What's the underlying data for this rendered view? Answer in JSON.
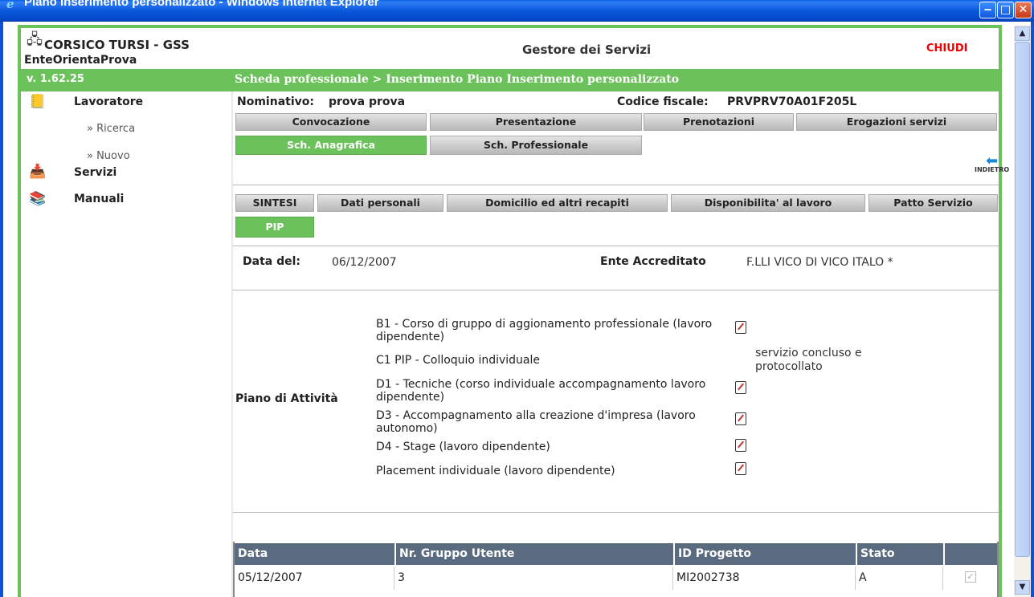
{
  "window": {
    "title": "Piano Inserimento personalizzato - Windows Internet Explorer",
    "minimize": "‒",
    "maximize": "□",
    "close": "✕"
  },
  "header": {
    "org": "CORSICO TURSI - GSS",
    "ente": "EnteOrientaProva",
    "app_title": "Gestore dei Servizi",
    "close_label": "CHIUDI"
  },
  "greenbar": {
    "version": "v. 1.62.25",
    "breadcrumb": "Scheda professionale > Inserimento Piano Inserimento personalizzato"
  },
  "sidebar": {
    "lavoratore": "Lavoratore",
    "ricerca": "» Ricerca",
    "nuovo": "» Nuovo",
    "servizi": "Servizi",
    "manuali": "Manuali"
  },
  "person": {
    "nominativo_label": "Nominativo:",
    "nominativo_value": "prova  prova",
    "cf_label": "Codice fiscale:",
    "cf_value": "PRVPRV70A01F205L"
  },
  "tabs_main": [
    "Convocazione",
    "Presentazione",
    "Prenotazioni",
    "Erogazioni servizi"
  ],
  "tabs_sub": [
    "Sch. Anagrafica",
    "Sch. Professionale"
  ],
  "back_label": "INDIETRO",
  "tabs_section": [
    "SINTESI",
    "Dati personali",
    "Domicilio ed altri recapiti",
    "Disponibilita' al lavoro",
    "Patto Servizio"
  ],
  "tab_pip": "PIP",
  "form": {
    "data_label": "Data del:",
    "data_value": "06/12/2007",
    "ente_label": "Ente Accreditato",
    "ente_value": "F.LLI VICO DI VICO ITALO *",
    "piano_label": "Piano di Attività"
  },
  "activities": [
    "B1 - Corso di gruppo di aggionamento professionale (lavoro dipendente)",
    "C1 PIP - Colloquio individuale",
    "D1 - Tecniche (corso individuale accompagnamento lavoro dipendente)",
    "D3 - Accompagnamento alla creazione d'impresa (lavoro autonomo)",
    "D4 - Stage (lavoro dipendente)",
    "Placement individuale (lavoro dipendente)"
  ],
  "activity_note": "servizio concluso e protocollato",
  "table": {
    "headers": [
      "Data",
      "Nr. Gruppo Utente",
      "ID Progetto",
      "Stato",
      ""
    ],
    "rows": [
      [
        "05/12/2007",
        "3",
        "MI2002738",
        "A",
        ""
      ]
    ]
  },
  "colors": {
    "accent_green": "#6cc25a",
    "table_header": "#5a6b80",
    "chiudi_red": "#e00000"
  }
}
